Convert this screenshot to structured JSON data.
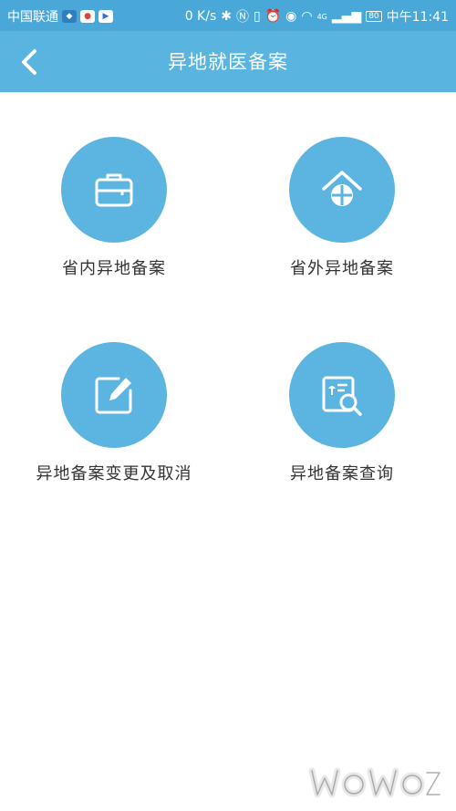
{
  "status_bar": {
    "carrier": "中国联通",
    "net_speed": "0 K/s",
    "network_type": "4G",
    "battery": "80",
    "time": "中午11:41"
  },
  "nav": {
    "title": "异地就医备案"
  },
  "tiles": [
    {
      "label": "省内异地备案",
      "icon": "briefcase-icon"
    },
    {
      "label": "省外异地备案",
      "icon": "home-crosshair-icon"
    },
    {
      "label": "异地备案变更及取消",
      "icon": "edit-icon"
    },
    {
      "label": "异地备案查询",
      "icon": "document-search-icon"
    }
  ],
  "colors": {
    "status_bar": "#4aa8d8",
    "nav_bar": "#5ab4e0",
    "tile_circle": "#5cb5e1",
    "label_text": "#333333"
  }
}
